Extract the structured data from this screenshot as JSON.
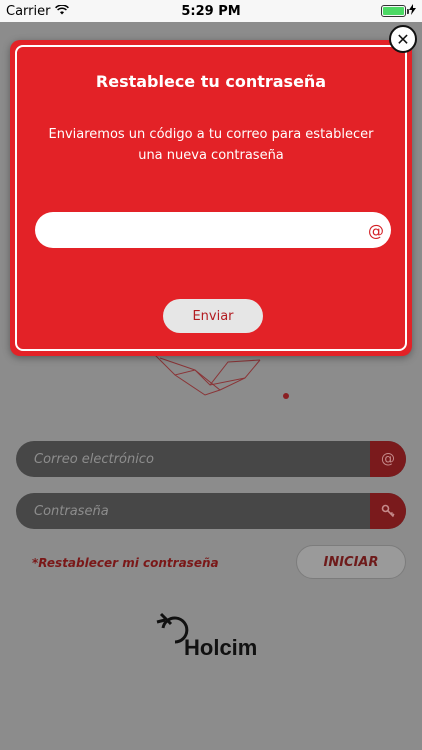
{
  "status_bar": {
    "carrier": "Carrier",
    "time": "5:29 PM"
  },
  "modal": {
    "title": "Restablece tu contraseña",
    "description": "Enviaremos un código a tu correo para establecer una nueva contraseña",
    "email_value": "",
    "email_icon": "@",
    "send_label": "Enviar",
    "close_icon": "✕"
  },
  "login": {
    "email_placeholder": "Correo electrónico",
    "email_icon": "@",
    "password_placeholder": "Contraseña",
    "password_icon": "key-icon",
    "reset_link": "*Restablecer mi contraseña",
    "login_button": "INICIAR"
  },
  "logo": {
    "text": "Holcim"
  },
  "colors": {
    "modal_red": "#e32227",
    "dark_field": "#474747"
  }
}
